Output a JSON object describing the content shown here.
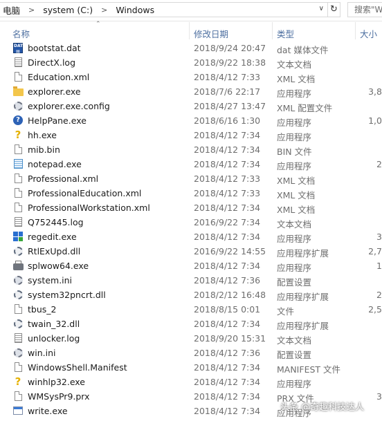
{
  "address": {
    "crumbs": [
      "电脑",
      "system (C:)",
      "Windows"
    ],
    "search_placeholder": "搜索\"Wi"
  },
  "columns": {
    "name": "名称",
    "date": "修改日期",
    "type": "类型",
    "size": "大小"
  },
  "files": [
    {
      "name": "bootstat.dat",
      "date": "2018/9/24 20:47",
      "type": "dat 媒体文件",
      "size": "",
      "icon": "dat-media-icon"
    },
    {
      "name": "DirectX.log",
      "date": "2018/9/22 18:38",
      "type": "文本文档",
      "size": "",
      "icon": "text-file-icon"
    },
    {
      "name": "Education.xml",
      "date": "2018/4/12 7:33",
      "type": "XML 文档",
      "size": "",
      "icon": "document-icon"
    },
    {
      "name": "explorer.exe",
      "date": "2018/7/6 22:17",
      "type": "应用程序",
      "size": "3,8",
      "icon": "folder-icon"
    },
    {
      "name": "explorer.exe.config",
      "date": "2018/4/27 13:47",
      "type": "XML 配置文件",
      "size": "",
      "icon": "config-gear-icon"
    },
    {
      "name": "HelpPane.exe",
      "date": "2018/6/16 1:30",
      "type": "应用程序",
      "size": "1,0",
      "icon": "help-icon"
    },
    {
      "name": "hh.exe",
      "date": "2018/4/12 7:34",
      "type": "应用程序",
      "size": "",
      "icon": "help-question-icon"
    },
    {
      "name": "mib.bin",
      "date": "2018/4/12 7:34",
      "type": "BIN 文件",
      "size": "",
      "icon": "document-icon"
    },
    {
      "name": "notepad.exe",
      "date": "2018/4/12 7:34",
      "type": "应用程序",
      "size": "2",
      "icon": "notepad-icon"
    },
    {
      "name": "Professional.xml",
      "date": "2018/4/12 7:33",
      "type": "XML 文档",
      "size": "",
      "icon": "document-icon"
    },
    {
      "name": "ProfessionalEducation.xml",
      "date": "2018/4/12 7:33",
      "type": "XML 文档",
      "size": "",
      "icon": "document-icon"
    },
    {
      "name": "ProfessionalWorkstation.xml",
      "date": "2018/4/12 7:34",
      "type": "XML 文档",
      "size": "",
      "icon": "document-icon"
    },
    {
      "name": "Q752445.log",
      "date": "2016/9/22 7:34",
      "type": "文本文档",
      "size": "",
      "icon": "text-file-icon"
    },
    {
      "name": "regedit.exe",
      "date": "2018/4/12 7:34",
      "type": "应用程序",
      "size": "3",
      "icon": "regedit-icon"
    },
    {
      "name": "RtlExUpd.dll",
      "date": "2016/9/22 14:55",
      "type": "应用程序扩展",
      "size": "2,7",
      "icon": "dll-gear-icon"
    },
    {
      "name": "splwow64.exe",
      "date": "2018/4/12 7:34",
      "type": "应用程序",
      "size": "1",
      "icon": "printer-icon"
    },
    {
      "name": "system.ini",
      "date": "2018/4/12 7:36",
      "type": "配置设置",
      "size": "",
      "icon": "config-gear-icon"
    },
    {
      "name": "system32pncrt.dll",
      "date": "2018/2/12 16:48",
      "type": "应用程序扩展",
      "size": "2",
      "icon": "dll-gear-icon"
    },
    {
      "name": "tbus_2",
      "date": "2018/8/15 0:01",
      "type": "文件",
      "size": "2,5",
      "icon": "document-icon"
    },
    {
      "name": "twain_32.dll",
      "date": "2018/4/12 7:34",
      "type": "应用程序扩展",
      "size": "",
      "icon": "dll-gear-icon"
    },
    {
      "name": "unlocker.log",
      "date": "2018/9/20 15:31",
      "type": "文本文档",
      "size": "",
      "icon": "text-file-icon"
    },
    {
      "name": "win.ini",
      "date": "2018/4/12 7:36",
      "type": "配置设置",
      "size": "",
      "icon": "config-gear-icon"
    },
    {
      "name": "WindowsShell.Manifest",
      "date": "2018/4/12 7:34",
      "type": "MANIFEST 文件",
      "size": "",
      "icon": "document-icon"
    },
    {
      "name": "winhlp32.exe",
      "date": "2018/4/12 7:34",
      "type": "应用程序",
      "size": "",
      "icon": "help-question-icon"
    },
    {
      "name": "WMSysPr9.prx",
      "date": "2018/4/12 7:34",
      "type": "PRX 文件",
      "size": "3",
      "icon": "document-icon"
    },
    {
      "name": "write.exe",
      "date": "2018/4/12 7:34",
      "type": "应用程序",
      "size": "",
      "icon": "app-window-icon"
    }
  ],
  "watermark": "头条 @奇趣科技达人"
}
